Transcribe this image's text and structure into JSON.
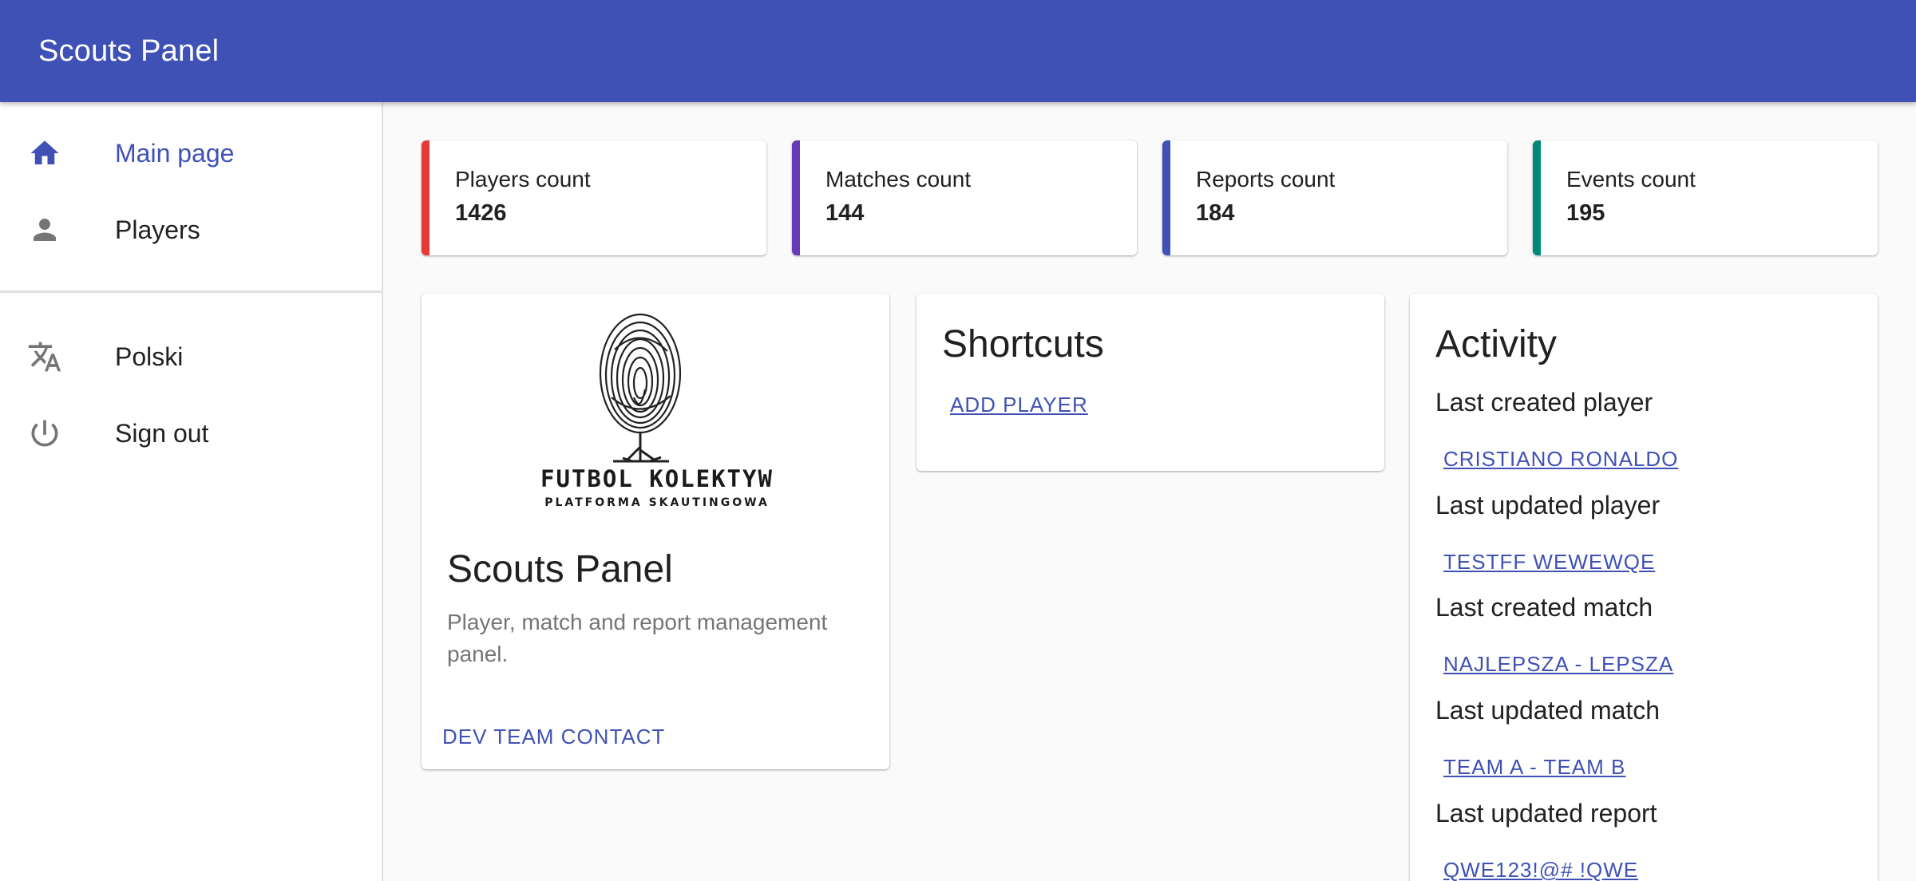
{
  "appbar": {
    "title": "Scouts Panel"
  },
  "sidebar": {
    "items": [
      {
        "label": "Main page",
        "icon": "home-icon",
        "active": true
      },
      {
        "label": "Players",
        "icon": "person-icon",
        "active": false
      }
    ],
    "secondary": [
      {
        "label": "Polski",
        "icon": "translate-icon"
      },
      {
        "label": "Sign out",
        "icon": "power-icon"
      }
    ]
  },
  "stats": [
    {
      "label": "Players count",
      "value": "1426",
      "color": "#e53935"
    },
    {
      "label": "Matches count",
      "value": "144",
      "color": "#673ab7"
    },
    {
      "label": "Reports count",
      "value": "184",
      "color": "#3f51b5"
    },
    {
      "label": "Events count",
      "value": "195",
      "color": "#00897b"
    }
  ],
  "about": {
    "logo_text": "FUTBOL KOLEKTYW",
    "logo_subtext": "PLATFORMA SKAUTINGOWA",
    "title": "Scouts Panel",
    "description": "Player, match and report management panel.",
    "contact_label": "DEV TEAM CONTACT"
  },
  "shortcuts": {
    "title": "Shortcuts",
    "add_player_label": "ADD PLAYER"
  },
  "activity": {
    "title": "Activity",
    "entries": [
      {
        "label": "Last created player",
        "link": "CRISTIANO RONALDO"
      },
      {
        "label": "Last updated player",
        "link": "TESTFF WEWEWQE"
      },
      {
        "label": "Last created match",
        "link": "NAJLEPSZA - LEPSZA"
      },
      {
        "label": "Last updated match",
        "link": "TEAM A - TEAM B"
      },
      {
        "label": "Last updated report",
        "link": "QWE123!@# !QWE"
      }
    ]
  },
  "colors": {
    "primary": "#3f51b5",
    "players_accent": "#e53935",
    "matches_accent": "#673ab7",
    "reports_accent": "#3f51b5",
    "events_accent": "#00897b"
  }
}
